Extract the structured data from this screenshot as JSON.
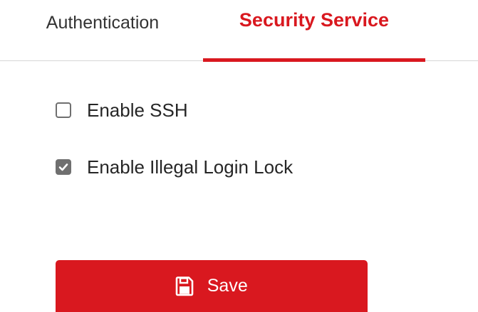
{
  "tabs": [
    {
      "label": "Authentication",
      "active": false
    },
    {
      "label": "Security Service",
      "active": true
    }
  ],
  "options": [
    {
      "label": "Enable SSH",
      "checked": false
    },
    {
      "label": "Enable Illegal Login Lock",
      "checked": true
    }
  ],
  "save_button": {
    "label": "Save",
    "icon": "save-icon"
  },
  "colors": {
    "accent": "#d9181f",
    "checkbox_checked": "#6f6f6f",
    "divider": "#d6d6d6",
    "text": "#262626"
  }
}
